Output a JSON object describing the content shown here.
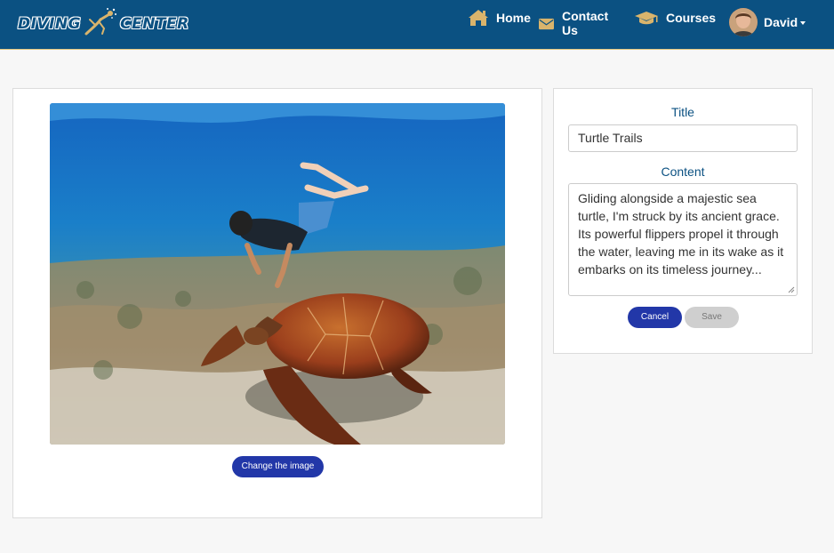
{
  "header": {
    "logo": {
      "word1": "DIVING",
      "word2": "CENTER"
    },
    "nav": {
      "home": {
        "label": "Home",
        "icon": "home-icon"
      },
      "contact": {
        "label": "Contact Us",
        "icon": "envelope-icon"
      },
      "courses": {
        "label": "Courses",
        "icon": "graduation-cap-icon"
      }
    },
    "user": {
      "name": "David",
      "icon": "chevron-down-icon"
    },
    "colors": {
      "background": "#0b5182",
      "icon": "#d9b46c"
    }
  },
  "image_panel": {
    "change_label": "Change the image"
  },
  "form": {
    "title_label": "Title",
    "title_value": "Turtle Trails",
    "content_label": "Content",
    "content_value": "Gliding alongside a majestic sea turtle, I'm struck by its ancient grace. Its powerful flippers propel it through the water, leaving me in its wake as it embarks on its timeless journey...",
    "cancel_label": "Cancel",
    "save_label": "Save"
  },
  "colors": {
    "primary_button": "#2237a8",
    "disabled_button": "#cfcfcf",
    "label": "#0b5182"
  }
}
